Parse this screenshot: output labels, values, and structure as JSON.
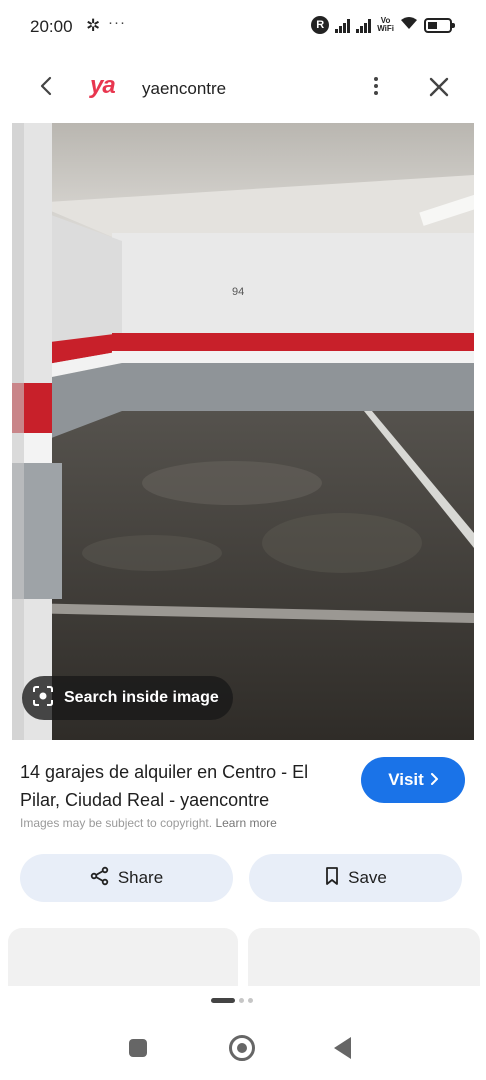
{
  "status_bar": {
    "time": "20:00",
    "network_label": "Vo\nWiFi",
    "badge_letter": "R"
  },
  "header": {
    "logo_text": "ya",
    "site_name": "yaencontre",
    "icons": [
      "back-icon",
      "more-vert-icon",
      "close-icon"
    ]
  },
  "image": {
    "search_label": "Search inside image",
    "wall_number": "94"
  },
  "result": {
    "title": "14 garajes de alquiler en Centro - El Pilar, Ciudad Real - yaencontre",
    "visit_label": "Visit",
    "copyright_text": "Images may be subject to copyright.",
    "learn_more": "Learn more"
  },
  "actions": {
    "share_label": "Share",
    "save_label": "Save"
  },
  "colors": {
    "brand": "#e8364f",
    "accent": "#1a73e8",
    "chip_bg": "#e8eef8"
  }
}
